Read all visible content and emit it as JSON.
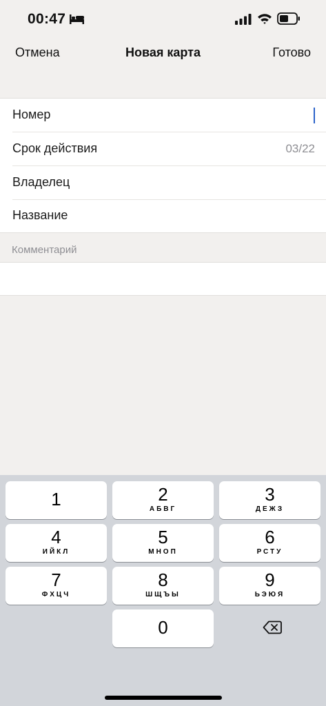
{
  "status_bar": {
    "time": "00:47"
  },
  "nav": {
    "cancel": "Отмена",
    "title": "Новая карта",
    "done": "Готово"
  },
  "form": {
    "rows": [
      {
        "label": "Номер",
        "value": ""
      },
      {
        "label": "Срок действия",
        "value": "03/22"
      },
      {
        "label": "Владелец",
        "value": ""
      },
      {
        "label": "Название",
        "value": ""
      }
    ],
    "comment_header": "Комментарий",
    "comment_value": ""
  },
  "keyboard": {
    "keys": [
      {
        "digit": "1",
        "letters": ""
      },
      {
        "digit": "2",
        "letters": "АБВГ"
      },
      {
        "digit": "3",
        "letters": "ДЕЖЗ"
      },
      {
        "digit": "4",
        "letters": "ИЙКЛ"
      },
      {
        "digit": "5",
        "letters": "МНОП"
      },
      {
        "digit": "6",
        "letters": "РСТУ"
      },
      {
        "digit": "7",
        "letters": "ФХЦЧ"
      },
      {
        "digit": "8",
        "letters": "ШЩЪЫ"
      },
      {
        "digit": "9",
        "letters": "ЬЭЮЯ"
      },
      {
        "digit": "0",
        "letters": ""
      }
    ],
    "delete_icon": "backspace-icon"
  },
  "colors": {
    "accent_cursor": "#2a62c9",
    "background": "#f2f0ee",
    "keyboard": "#d2d5da"
  }
}
